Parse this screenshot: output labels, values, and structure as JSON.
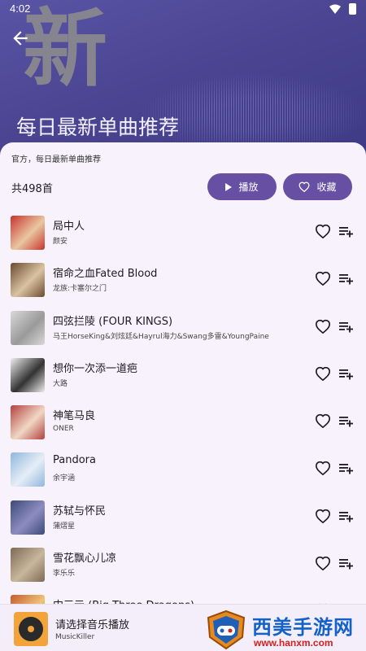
{
  "status": {
    "time": "4:02"
  },
  "hero": {
    "big_char": "新",
    "title": "每日最新单曲推荐"
  },
  "sheet": {
    "description": "官方，每日最新单曲推荐",
    "count": "共498首",
    "play_label": "播放",
    "fav_label": "收藏"
  },
  "songs": [
    {
      "title": "局中人",
      "artist": "颜安",
      "cover_colors": [
        "#c8332e",
        "#e9c7a0"
      ]
    },
    {
      "title": "宿命之血Fated Blood",
      "artist": "龙族:卡塞尔之门",
      "cover_colors": [
        "#6b4a2f",
        "#d9c3a2"
      ]
    },
    {
      "title": "四弦拦陵 (FOUR KINGS)",
      "artist": "马王HorseKing&刘炫廷&Hayrul海力&Swang多雷&YoungPaine",
      "cover_colors": [
        "#d9d9d9",
        "#9a9a9a"
      ]
    },
    {
      "title": "想你一次添一道疤",
      "artist": "大路",
      "cover_colors": [
        "#eeeeee",
        "#333333"
      ]
    },
    {
      "title": "神笔马良",
      "artist": "ONER",
      "cover_colors": [
        "#b3413e",
        "#f0d7c4"
      ]
    },
    {
      "title": "Pandora",
      "artist": "余宇涵",
      "cover_colors": [
        "#8fb6de",
        "#e6eef6"
      ]
    },
    {
      "title": "苏轼与怀民",
      "artist": "蒲熠星",
      "cover_colors": [
        "#3c4a7a",
        "#8e8cc1"
      ]
    },
    {
      "title": "雪花飘心儿凉",
      "artist": "李乐乐",
      "cover_colors": [
        "#7d6a55",
        "#c8b79c"
      ]
    },
    {
      "title": "中三元 (Big Three Dragons)",
      "artist": "",
      "cover_colors": [
        "#c55a2c",
        "#efc37a"
      ]
    }
  ],
  "player": {
    "title": "请选择音乐播放",
    "subtitle": "MusicKiller"
  },
  "watermark": {
    "text": "西美手游网",
    "url": "www.hanxm.com"
  },
  "colors": {
    "accent": "#6750a4",
    "hero": "#4b4592"
  }
}
